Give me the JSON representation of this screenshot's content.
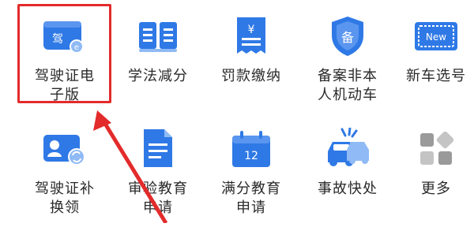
{
  "colors": {
    "icon_blue": "#2f79e6",
    "icon_light": "#8fbaf5",
    "highlight_red": "#e32b2b",
    "gray_more": "#9a9a9a"
  },
  "menu": [
    {
      "label": "驾驶证电\n子版",
      "icon": "license-card-icon",
      "icon_text": "驾"
    },
    {
      "label": "学法减分",
      "icon": "open-book-icon"
    },
    {
      "label": "罚款缴纳",
      "icon": "receipt-yen-icon",
      "icon_text": "¥"
    },
    {
      "label": "备案非本\n人机动车",
      "icon": "shield-badge-icon",
      "icon_text": "备"
    },
    {
      "label": "新车选号",
      "icon": "license-plate-icon",
      "icon_text": "New"
    },
    {
      "label": "驾驶证补\n换领",
      "icon": "id-card-refresh-icon"
    },
    {
      "label": "审验教育\n申请",
      "icon": "document-icon"
    },
    {
      "label": "满分教育\n申请",
      "icon": "calendar-icon",
      "icon_text": "12"
    },
    {
      "label": "事故快处",
      "icon": "car-accident-icon"
    },
    {
      "label": "更多",
      "icon": "more-grid-icon"
    }
  ]
}
